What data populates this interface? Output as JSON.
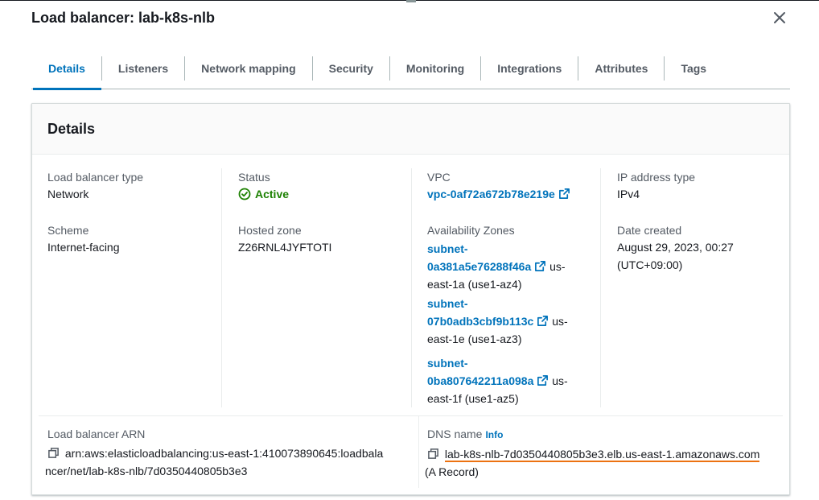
{
  "header": {
    "title": "Load balancer: lab-k8s-nlb"
  },
  "tabs": [
    {
      "label": "Details"
    },
    {
      "label": "Listeners"
    },
    {
      "label": "Network mapping"
    },
    {
      "label": "Security"
    },
    {
      "label": "Monitoring"
    },
    {
      "label": "Integrations"
    },
    {
      "label": "Attributes"
    },
    {
      "label": "Tags"
    }
  ],
  "details": {
    "heading": "Details",
    "lb_type_label": "Load balancer type",
    "lb_type_value": "Network",
    "scheme_label": "Scheme",
    "scheme_value": "Internet-facing",
    "status_label": "Status",
    "status_value": "Active",
    "hosted_zone_label": "Hosted zone",
    "hosted_zone_value": "Z26RNL4JYFTOTI",
    "vpc_label": "VPC",
    "vpc_value": "vpc-0af72a672b78e219e",
    "az_label": "Availability Zones",
    "subnets": [
      {
        "line1": "subnet-",
        "line2": "0a381a5e76288f46a",
        "tail": "us-",
        "zone": "east-1a (use1-az4)"
      },
      {
        "line1": "subnet-",
        "line2": "07b0adb3cbf9b113c",
        "tail": "us-",
        "zone": "east-1e (use1-az3)"
      },
      {
        "line1": "subnet-",
        "line2": "0ba807642211a098a",
        "tail": "us-",
        "zone": "east-1f (use1-az5)"
      }
    ],
    "ip_type_label": "IP address type",
    "ip_type_value": "IPv4",
    "date_label": "Date created",
    "date_value_1": "August 29, 2023, 00:27",
    "date_value_2": "(UTC+09:00)",
    "arn_label": "Load balancer ARN",
    "arn_line1": "arn:aws:elasticloadbalancing:us-east-1:410073890645:loadbala",
    "arn_line2": "ncer/net/lab-k8s-nlb/7d0350440805b3e3",
    "dns_label": "DNS name",
    "dns_info": "Info",
    "dns_value": "lab-k8s-nlb-7d0350440805b3e3.elb.us-east-1.amazonaws.com",
    "dns_record": "(A Record)"
  },
  "colors": {
    "accent": "#0073bb",
    "success": "#1d8102",
    "highlight": "#ec7211"
  }
}
